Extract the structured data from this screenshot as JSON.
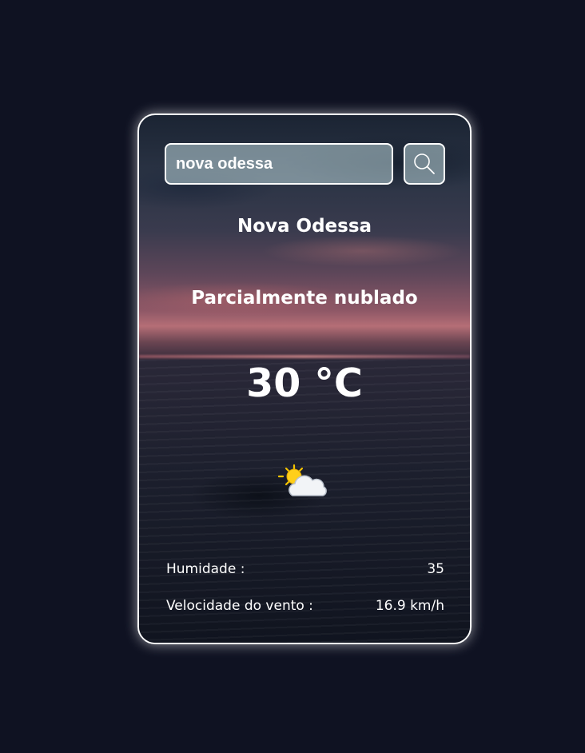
{
  "search": {
    "value": "nova odessa"
  },
  "weather": {
    "city": "Nova Odessa",
    "condition": "Parcialmente nublado",
    "temperature": "30 °C",
    "icon": "partly-cloudy-icon"
  },
  "stats": {
    "humidity_label": "Humidade :",
    "humidity_value": "35",
    "wind_label": "Velocidade do vento :",
    "wind_value": "16.9 km/h"
  },
  "colors": {
    "page_background": "#0f1222",
    "card_border": "#ffffff",
    "text": "#ffffff"
  }
}
